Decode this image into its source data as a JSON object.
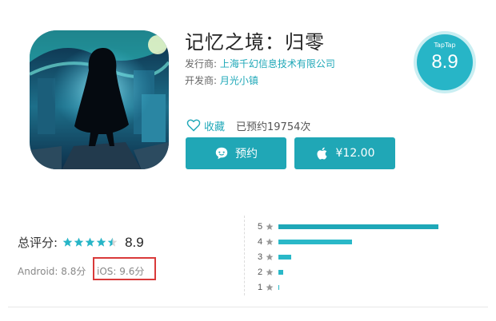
{
  "app": {
    "title": "记忆之境：归零",
    "publisher_label": "发行商:",
    "publisher": "上海千幻信息技术有限公司",
    "developer_label": "开发商:",
    "developer": "月光小镇"
  },
  "badge": {
    "brand": "TapTap",
    "score": "8.9"
  },
  "actions": {
    "favorite_label": "收藏",
    "reserve_count": "已预约19754次",
    "reserve_button": "预约",
    "price_button": "¥12.00"
  },
  "rating": {
    "total_label": "总评分:",
    "total_score": "8.9",
    "stars_filled": 4.5,
    "android": "Android: 8.8分",
    "ios": "iOS: 9.6分",
    "distribution": [
      {
        "stars": "5",
        "fraction": 0.87
      },
      {
        "stars": "4",
        "fraction": 0.4
      },
      {
        "stars": "3",
        "fraction": 0.07
      },
      {
        "stars": "2",
        "fraction": 0.025
      },
      {
        "stars": "1",
        "fraction": 0.005
      }
    ]
  },
  "colors": {
    "accent": "#20a7b6",
    "highlight": "#d93a3a",
    "badge": "#27b5c7"
  },
  "icons": [
    "app-icon",
    "heart-icon",
    "chat-bubble-icon",
    "apple-icon",
    "star-icon"
  ]
}
